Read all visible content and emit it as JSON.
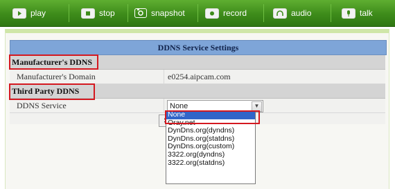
{
  "toolbar": {
    "buttons": [
      {
        "label": "play",
        "icon": "play-icon"
      },
      {
        "label": "stop",
        "icon": "stop-icon"
      },
      {
        "label": "snapshot",
        "icon": "camera-icon"
      },
      {
        "label": "record",
        "icon": "record-icon"
      },
      {
        "label": "audio",
        "icon": "headphones-icon"
      },
      {
        "label": "talk",
        "icon": "microphone-icon"
      }
    ]
  },
  "settings": {
    "title": "DDNS Service Settings",
    "manufacturer_section": "Manufacturer's DDNS",
    "domain_label": "Manufacturer's Domain",
    "domain_value": "e0254.aipcam.com",
    "third_party_section": "Third Party DDNS",
    "service_label": "DDNS Service",
    "service_selected": "None",
    "save_label": "S"
  },
  "dropdown": {
    "options": [
      "None",
      "Oray.net",
      "DynDns.org(dyndns)",
      "DynDns.org(statdns)",
      "DynDns.org(custom)",
      "3322.org(dyndns)",
      "3322.org(statdns)"
    ],
    "selected_index": 0
  },
  "colors": {
    "toolbar_green": "#3d8b1a",
    "header_blue": "#7ea5d8",
    "highlight_red": "#d4181f",
    "selection_blue": "#3165c9"
  }
}
